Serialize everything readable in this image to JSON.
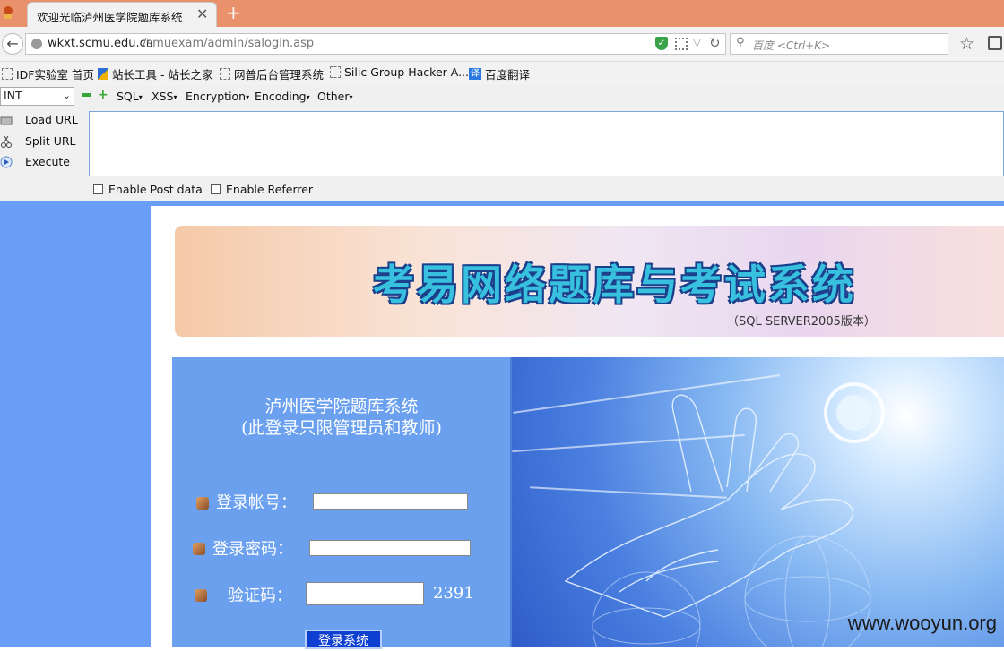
{
  "browser": {
    "tab_title": "欢迎光临泸州医学院题库系统",
    "tab_close": "✕",
    "new_tab": "+",
    "url_host": "wkxt.scmu.edu.cn",
    "url_path": "/smuexam/admin/salogin.asp",
    "search_placeholder": "百度 <Ctrl+K>"
  },
  "bookmarks": [
    {
      "label": "IDF实验室 首页",
      "icon": "page-icon"
    },
    {
      "label": "站长工具 - 站长之家",
      "icon": "tool-icon"
    },
    {
      "label": "网普后台管理系统",
      "icon": "page-icon"
    },
    {
      "label": "Silic Group Hacker A...",
      "icon": "page-icon"
    },
    {
      "label": "百度翻译",
      "icon": "translate-icon",
      "glyph": "译"
    }
  ],
  "hackbar": {
    "select_value": "INT",
    "menus": [
      "SQL",
      "XSS",
      "Encryption",
      "Encoding",
      "Other"
    ],
    "actions": {
      "load": "Load URL",
      "split": "Split URL",
      "execute": "Execute"
    },
    "post_label": "Enable Post data",
    "referrer_label": "Enable Referrer"
  },
  "page": {
    "banner_title": "考易网络题库与考试系统",
    "banner_subtitle": "（SQL SERVER2005版本）",
    "login_title": "泸州医学院题库系统",
    "login_subtitle": "(此登录只限管理员和教师)",
    "account_label": "登录帐号：",
    "password_label": "登录密码：",
    "captcha_label": "验证码：",
    "captcha_value": "2391",
    "submit_label": "登录系统",
    "watermark": "www.wooyun.org"
  },
  "colors": {
    "tabbar": "#e8916a",
    "page_bg": "#6a9df5",
    "login_panel": "#6aa0ee",
    "submit": "#0d3fd0"
  }
}
